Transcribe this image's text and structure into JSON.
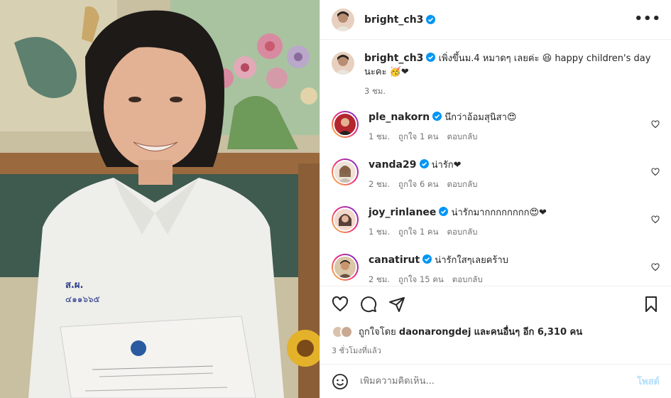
{
  "post": {
    "author": "bright_ch3",
    "more_label": "•••"
  },
  "caption": {
    "author": "bright_ch3",
    "text": "เพิ่งขึ้นม.4 หมาดๆ เลยค่ะ 😆 happy children's day นะคะ 🥳❤",
    "time": "3 ชม."
  },
  "comments": [
    {
      "user": "ple_nakorn",
      "text": "นึกว่าอ้อมสุนิสา😍",
      "time": "1 ชม.",
      "likes": "ถูกใจ 1 คน",
      "reply": "ตอบกลับ",
      "av_color": "#b3262d"
    },
    {
      "user": "vanda29",
      "text": "น่ารัก❤",
      "time": "2 ชม.",
      "likes": "ถูกใจ 6 คน",
      "reply": "ตอบกลับ",
      "av_color": "#d8b6a0"
    },
    {
      "user": "joy_rinlanee",
      "text": "น่ารักมากกกกกกกก😍❤",
      "time": "1 ชม.",
      "likes": "ถูกใจ 1 คน",
      "reply": "ตอบกลับ",
      "av_color": "#c9847a"
    },
    {
      "user": "canatirut",
      "text": "น่ารักใสๆเลยคร้าบ",
      "time": "2 ชม.",
      "likes": "ถูกใจ 15 คน",
      "reply": "ตอบกลับ",
      "av_color": "#8a6a50"
    }
  ],
  "likes": {
    "prefix": "ถูกใจโดย",
    "user": "daonarongdej",
    "rest": "และคนอื่นๆ อีก 6,310 คน"
  },
  "timestamp": "3 ชั่วโมงที่แล้ว",
  "composer": {
    "placeholder": "เพิ่มความคิดเห็น...",
    "post_label": "โพสต์"
  },
  "colors": {
    "verified": "#0095f6",
    "meta": "#737373",
    "post_disabled": "#b2dffc",
    "heart": "#ed4956"
  }
}
